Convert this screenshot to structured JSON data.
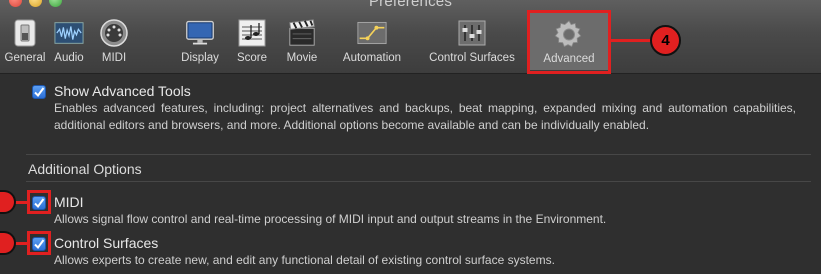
{
  "window": {
    "title": "Preferences"
  },
  "toolbar": {
    "tabs": [
      {
        "id": "general",
        "label": "General",
        "icon": "switch-icon"
      },
      {
        "id": "audio",
        "label": "Audio",
        "icon": "waveform-icon"
      },
      {
        "id": "midi",
        "label": "MIDI",
        "icon": "midi-connector-icon"
      },
      {
        "id": "display",
        "label": "Display",
        "icon": "monitor-icon"
      },
      {
        "id": "score",
        "label": "Score",
        "icon": "sheet-music-icon"
      },
      {
        "id": "movie",
        "label": "Movie",
        "icon": "clapperboard-icon"
      },
      {
        "id": "automation",
        "label": "Automation",
        "icon": "automation-curve-icon"
      },
      {
        "id": "control-surfaces",
        "label": "Control Surfaces",
        "icon": "faders-icon"
      },
      {
        "id": "advanced",
        "label": "Advanced",
        "icon": "gear-icon",
        "selected": true
      }
    ]
  },
  "content": {
    "show_advanced": {
      "title": "Show Advanced Tools",
      "checked": true,
      "description": "Enables advanced features, including: project alternatives and backups, beat mapping, expanded mixing and automation capabilities, additional editors and browsers, and more. Additional options become available and can be individually enabled."
    },
    "section_title": "Additional Options",
    "options": [
      {
        "title": "MIDI",
        "checked": true,
        "description": "Allows signal flow control and real-time processing of MIDI input and output streams in the Environment."
      },
      {
        "title": "Control Surfaces",
        "checked": true,
        "description": "Allows experts to create new, and edit any functional detail of existing control surface systems."
      }
    ]
  },
  "annotations": {
    "advanced_callout": "4",
    "highlight_color": "#e02020"
  }
}
